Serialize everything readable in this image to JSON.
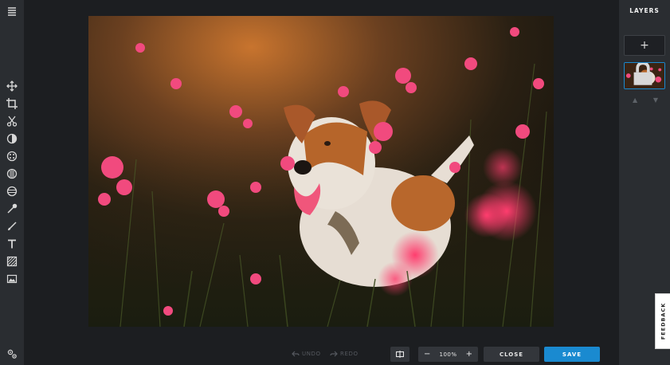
{
  "toolbar": {
    "tools": [
      {
        "name": "menu-icon"
      },
      {
        "name": "move-icon"
      },
      {
        "name": "crop-icon"
      },
      {
        "name": "cut-icon"
      },
      {
        "name": "adjust-icon"
      },
      {
        "name": "filters-icon"
      },
      {
        "name": "vignette-icon"
      },
      {
        "name": "effects-icon"
      },
      {
        "name": "pipette-icon"
      },
      {
        "name": "brush-icon"
      },
      {
        "name": "text-icon"
      },
      {
        "name": "pattern-icon"
      },
      {
        "name": "image-icon"
      },
      {
        "name": "settings-icon"
      }
    ]
  },
  "history": {
    "undo_label": "UNDO",
    "redo_label": "REDO"
  },
  "zoom": {
    "value": "100%",
    "minus": "−",
    "plus": "+"
  },
  "actions": {
    "close_label": "CLOSE",
    "save_label": "SAVE"
  },
  "layers": {
    "title": "LAYERS",
    "add_label": "+",
    "up_arrow": "▲",
    "down_arrow": "▼"
  },
  "feedback_label": "FEEDBACK",
  "colors": {
    "accent": "#1a8ad0",
    "panel": "#2a2d31",
    "canvas_bg": "#1c1e21"
  }
}
